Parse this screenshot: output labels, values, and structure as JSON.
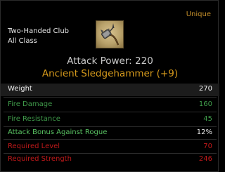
{
  "item": {
    "rarity": "Unique",
    "weapon_type": "Two-Handed Club",
    "class_requirement": "All Class",
    "icon": "sledgehammer-icon",
    "attack_power": "Attack Power: 220",
    "name": "Ancient Sledgehammer (+9)"
  },
  "weight": {
    "label": "Weight",
    "value": "270"
  },
  "stats": [
    {
      "label": "Fire Damage",
      "value": "160",
      "color": "#3f9a4a"
    },
    {
      "label": "Fire Resistance",
      "value": "45",
      "color": "#3f9a4a"
    },
    {
      "label": "Attack Bonus Against Rogue",
      "value": "12%",
      "color": "#59c262"
    },
    {
      "label": "Required Level",
      "value": "70",
      "color": "#c0191a"
    },
    {
      "label": "Required Strength",
      "value": "246",
      "color": "#c0191a"
    }
  ],
  "colors": {
    "rarity": "#c7912b",
    "item_name": "#d69a1c",
    "attack_power": "#c8c8c8"
  }
}
